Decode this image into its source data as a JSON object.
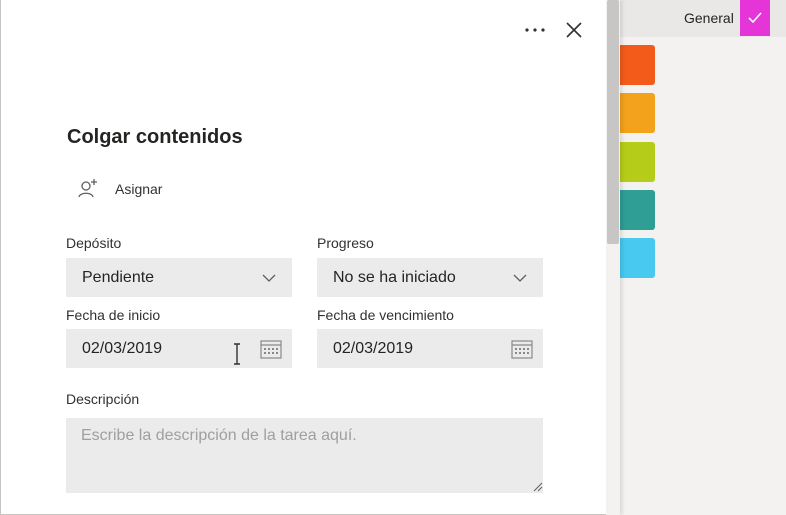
{
  "background": {
    "general_label": "General",
    "accent_color": "#e535d8",
    "swatches": [
      "#f25b1a",
      "#f2a21b",
      "#b5cc18",
      "#2f9e95",
      "#47c9f0"
    ]
  },
  "panel": {
    "more_icon": "more-icon",
    "close_icon": "close-icon",
    "title": "Colgar contenidos",
    "assign_label": "Asignar",
    "bucket": {
      "label": "Depósito",
      "value": "Pendiente"
    },
    "progress": {
      "label": "Progreso",
      "value": "No se ha iniciado"
    },
    "start_date": {
      "label": "Fecha de inicio",
      "value": "02/03/2019"
    },
    "due_date": {
      "label": "Fecha de vencimiento",
      "value": "02/03/2019"
    },
    "description": {
      "label": "Descripción",
      "placeholder": "Escribe la descripción de la tarea aquí."
    }
  }
}
